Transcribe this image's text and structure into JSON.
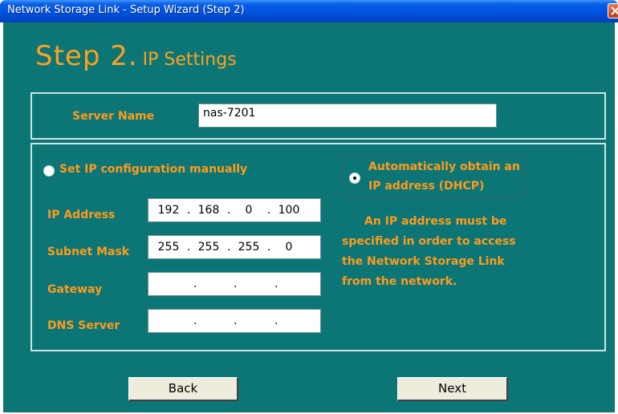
{
  "window": {
    "title": "Network Storage Link - Setup Wizard (Step 2)"
  },
  "heading": {
    "step": "Step 2.",
    "subtitle": "IP Settings"
  },
  "server": {
    "label": "Server Name",
    "value": "nas-7201"
  },
  "manual_option": {
    "label": "Set IP configuration manually",
    "selected": false
  },
  "dhcp_option": {
    "line1": "Automatically obtain an",
    "line2": "IP address (DHCP)",
    "selected": true
  },
  "fields": {
    "ip_address": {
      "label": "IP Address",
      "octets": [
        "192",
        "168",
        "0",
        "100"
      ]
    },
    "subnet_mask": {
      "label": "Subnet Mask",
      "octets": [
        "255",
        "255",
        "255",
        "0"
      ]
    },
    "gateway": {
      "label": "Gateway",
      "octets": [
        "",
        "",
        "",
        ""
      ]
    },
    "dns_server": {
      "label": "DNS Server",
      "octets": [
        "",
        "",
        "",
        ""
      ]
    }
  },
  "note": {
    "line1": "An IP address must be",
    "line2": "specified in order to access",
    "line3": "the Network Storage Link",
    "line4": "from the network."
  },
  "buttons": {
    "back": "Back",
    "next": "Next"
  },
  "colors": {
    "background": "#0c7676",
    "label": "#ff9a1c",
    "titlebar": "#0054e3"
  }
}
